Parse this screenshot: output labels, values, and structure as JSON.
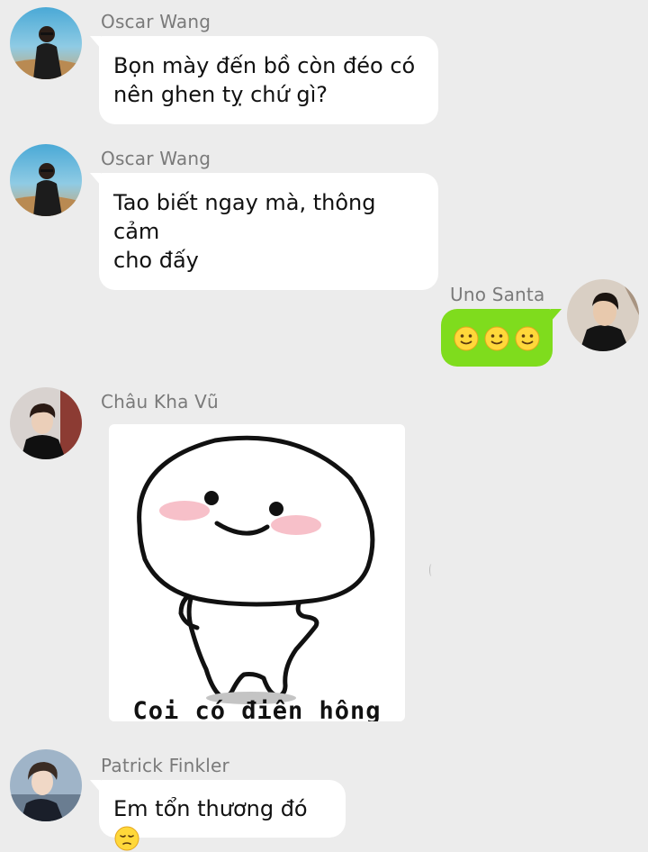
{
  "messages": [
    {
      "sender": "Oscar Wang",
      "avatar": "man-in-desert-avatar",
      "text_lines": [
        "Bọn mày đến bồ còn đéo có",
        "nên ghen tỵ chứ gì?"
      ]
    },
    {
      "sender": "Oscar Wang",
      "avatar": "man-in-desert-avatar",
      "text_lines": [
        "Tao biết ngay mà, thông cảm",
        "cho đấy"
      ]
    },
    {
      "sender": "Uno Santa",
      "avatar": "man-in-black-avatar",
      "emoji": [
        "slightly-smiling-face",
        "slightly-smiling-face",
        "slightly-smiling-face"
      ],
      "outgoing": true
    },
    {
      "sender": "Châu Kha Vũ",
      "avatar": "man-in-suit-avatar",
      "sticker": {
        "name": "white-blob-sticker",
        "caption": "Coi có điên hông"
      }
    },
    {
      "sender": "Patrick Finkler",
      "avatar": "man-portrait-avatar",
      "text": "Em tổn thương đó",
      "emoji": "pensive-face"
    }
  ],
  "colors": {
    "background": "#ececec",
    "incoming_bubble": "#ffffff",
    "outgoing_bubble": "#7fdc1d",
    "sender_name": "#7a7a7a"
  }
}
